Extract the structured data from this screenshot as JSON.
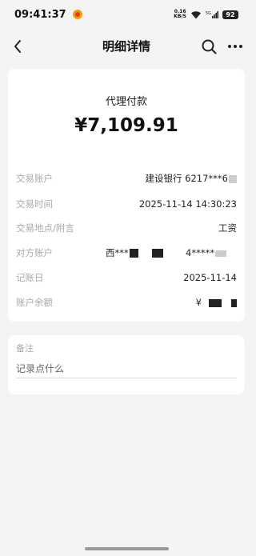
{
  "status_bar": {
    "time": "09:41:37",
    "net_speed_value": "0.16",
    "net_speed_unit": "KB/S",
    "battery": "92"
  },
  "nav": {
    "title": "明细详情"
  },
  "detail": {
    "type": "代理付款",
    "amount": "¥7,109.91",
    "rows": {
      "account": {
        "label": "交易账户",
        "value": "建设银行 6217***6"
      },
      "time": {
        "label": "交易时间",
        "value": "2025-11-14 14:30:23"
      },
      "place": {
        "label": "交易地点/附言",
        "value": "工资"
      },
      "counterparty": {
        "label": "对方账户",
        "name": "西***",
        "account": "4*****"
      },
      "book_date": {
        "label": "记账日",
        "value": "2025-11-14"
      },
      "balance": {
        "label": "账户余额",
        "value": "¥"
      }
    }
  },
  "note": {
    "label": "备注",
    "placeholder": "记录点什么"
  }
}
